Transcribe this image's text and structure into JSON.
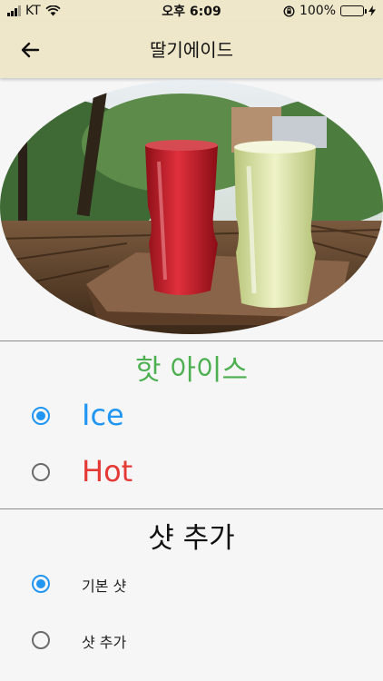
{
  "status_bar": {
    "carrier": "KT",
    "time": "오후 6:09",
    "battery_percent": "100%",
    "battery_level": 1.0
  },
  "app_bar": {
    "title": "딸기에이드",
    "back_icon": "arrow-left-icon"
  },
  "temperature": {
    "title": "핫 아이스",
    "title_color": "#4caf50",
    "options": [
      {
        "label": "Ice",
        "selected": true,
        "color": "#2196f3"
      },
      {
        "label": "Hot",
        "selected": false,
        "color": "#e53935"
      }
    ]
  },
  "shot": {
    "title": "샷 추가",
    "options": [
      {
        "label": "기본 샷",
        "selected": true
      },
      {
        "label": "샷 추가",
        "selected": false
      }
    ]
  }
}
